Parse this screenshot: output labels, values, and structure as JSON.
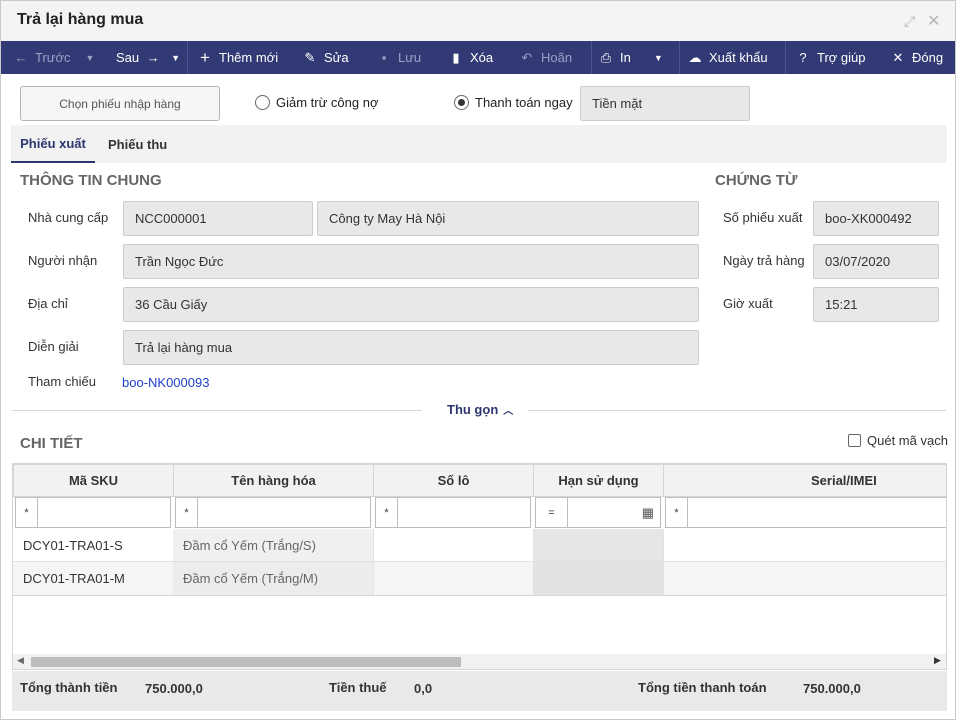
{
  "window": {
    "title": "Trả lại hàng mua"
  },
  "toolbar": {
    "prev": "Trước",
    "next": "Sau",
    "add": "Thêm mới",
    "edit": "Sửa",
    "save": "Lưu",
    "delete": "Xóa",
    "undo": "Hoãn",
    "print": "In",
    "export": "Xuất khẩu",
    "help": "Trợ giúp",
    "close": "Đóng"
  },
  "options": {
    "select_receipt": "Chọn phiếu nhập hàng",
    "radio_debt": "Giảm trừ công nợ",
    "radio_pay": "Thanh toán ngay",
    "pay_method": "Tiền mặt",
    "selected": "pay"
  },
  "tabs": [
    {
      "label": "Phiếu xuất",
      "active": true
    },
    {
      "label": "Phiếu thu",
      "active": false
    }
  ],
  "general": {
    "heading": "THÔNG TIN CHUNG",
    "supplier_label": "Nhà cung cấp",
    "supplier_code": "NCC000001",
    "supplier_name": "Công ty May Hà Nội",
    "receiver_label": "Người nhận",
    "receiver": "Trần Ngọc Đức",
    "address_label": "Địa chỉ",
    "address": "36 Cầu Giấy",
    "note_label": "Diễn giải",
    "note": "Trả lại hàng mua",
    "ref_label": "Tham chiếu",
    "ref": "boo-NK000093"
  },
  "voucher": {
    "heading": "CHỨNG TỪ",
    "no_label": "Số phiếu xuất",
    "no": "boo-XK000492",
    "date_label": "Ngày trả hàng",
    "date": "03/07/2020",
    "time_label": "Giờ xuất",
    "time": "15:21"
  },
  "collapse": "Thu gọn",
  "detail": {
    "heading": "CHI TIẾT",
    "scan_label": "Quét mã vạch",
    "columns": [
      "Mã SKU",
      "Tên hàng hóa",
      "Số lô",
      "Hạn sử dụng",
      "Serial/IMEI"
    ],
    "filter_ops": [
      "*",
      "*",
      "*",
      "=",
      "*"
    ],
    "rows": [
      {
        "sku": "DCY01-TRA01-S",
        "name": "Đầm cổ Yếm (Trắng/S)"
      },
      {
        "sku": "DCY01-TRA01-M",
        "name": "Đầm cổ Yếm (Trắng/M)"
      }
    ]
  },
  "totals": {
    "total_label": "Tổng thành tiền",
    "total": "750.000,0",
    "tax_label": "Tiền thuế",
    "tax": "0,0",
    "pay_label": "Tổng tiền thanh toán",
    "pay": "750.000,0"
  },
  "colors": {
    "toolbar": "#313a74",
    "accent": "#2d3670",
    "link": "#1f3ec9"
  }
}
